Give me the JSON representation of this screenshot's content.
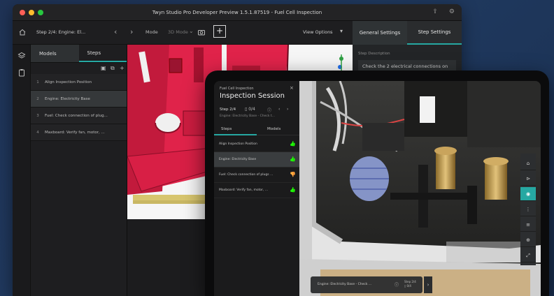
{
  "window": {
    "title": "Twyn Studio Pro Developer Preview 1.5.1.87519 - Fuel Cell Inspection",
    "traffic_lights": [
      "#ff5f57",
      "#febc2e",
      "#28c840"
    ]
  },
  "titlebar_icons": [
    "share-icon",
    "settings-icon"
  ],
  "toolbar": {
    "step_select": "Step 2/4: Engine: El...",
    "prev_arrow": "‹",
    "next_arrow": "›",
    "mode_label": "Mode",
    "mode_value": "3D Mode",
    "add_label": "+",
    "view_options": "View Options",
    "view_caret": "▾"
  },
  "right_tabs": [
    "General Settings",
    "Step Settings"
  ],
  "left_panel": {
    "tabs": [
      "Models",
      "Steps"
    ],
    "tool_icons": [
      "▣",
      "⧉",
      "+"
    ],
    "steps": [
      {
        "num": "1",
        "label": "Align Inspection Position"
      },
      {
        "num": "2",
        "label": "Engine: Electricity Base"
      },
      {
        "num": "3",
        "label": "Fuel: Check connection of plug..."
      },
      {
        "num": "4",
        "label": "Maxboard: Verify fan, motor, ..."
      }
    ],
    "selected_index": 1
  },
  "right_panel": {
    "label": "Step Description",
    "description": "Check the 2 electrical connections on"
  },
  "ipad": {
    "supertitle": "Fuel Cell Inspection",
    "close": "×",
    "title": "Inspection Session",
    "step": "Step 2/4",
    "step_sub": "Engine: Electricity Base - Check t...",
    "doc_count": "▯ 0/4",
    "tabs": [
      "Steps",
      "Models"
    ],
    "steps": [
      {
        "label": "Align Inspection Position",
        "status": "ok"
      },
      {
        "label": "Engine: Electricity Base",
        "status": "ok"
      },
      {
        "label": "Fuel: Check connection of plugs ...",
        "status": "warn"
      },
      {
        "label": "Maxboard: Verify fan, motor, ...",
        "status": "ok"
      }
    ],
    "selected_index": 1,
    "status_icons": {
      "ok": "👍",
      "warn": "👎"
    },
    "status_colors": {
      "ok": "#3fb950",
      "warn": "#e5534b"
    },
    "bottom_bar": {
      "text": "Engine: Electricity Base - Check ...",
      "step_line1": "Step 2/4",
      "step_line2": "▯ 0/4",
      "info": "ⓘ",
      "next": "›"
    },
    "tools": [
      "⌂",
      "⊳",
      "◉",
      "⋮",
      "≡",
      "⊕",
      "⤢"
    ],
    "active_tool": 2
  },
  "colors": {
    "accent": "#26a8a2",
    "model_red": "#e0234a"
  }
}
